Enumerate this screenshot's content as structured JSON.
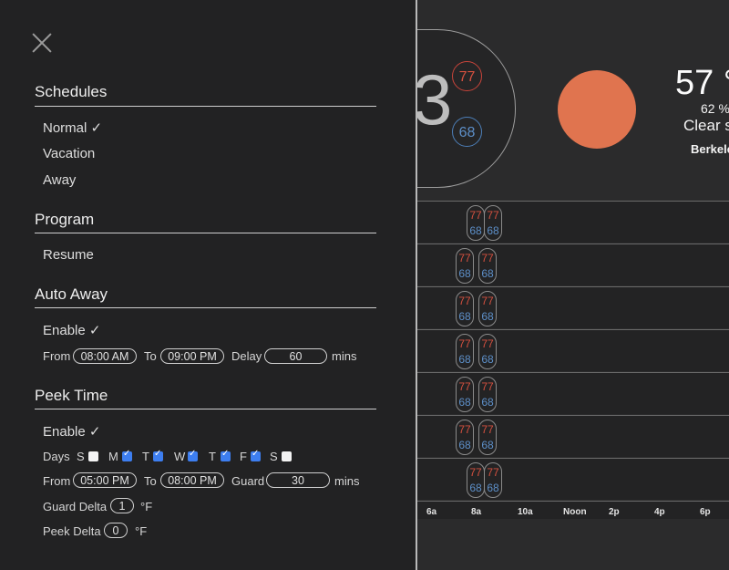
{
  "sidebar": {
    "close_icon": "close-icon",
    "schedules": {
      "title": "Schedules",
      "items": [
        "Normal ✓",
        "Vacation",
        "Away"
      ]
    },
    "program": {
      "title": "Program",
      "items": [
        "Resume"
      ]
    },
    "auto_away": {
      "title": "Auto Away",
      "enable": "Enable ✓",
      "from_label": "From",
      "from_value": "08:00 AM",
      "to_label": "To",
      "to_value": "09:00 PM",
      "delay_label": "Delay",
      "delay_value": "60",
      "delay_unit": "mins"
    },
    "peek_time": {
      "title": "Peek Time",
      "enable": "Enable ✓",
      "days_label": "Days",
      "days": [
        {
          "label": "S",
          "checked": false
        },
        {
          "label": "M",
          "checked": true
        },
        {
          "label": "T",
          "checked": true
        },
        {
          "label": "W",
          "checked": true
        },
        {
          "label": "T",
          "checked": true
        },
        {
          "label": "F",
          "checked": true
        },
        {
          "label": "S",
          "checked": false
        }
      ],
      "from_label": "From",
      "from_value": "05:00 PM",
      "to_label": "To",
      "to_value": "08:00 PM",
      "guard_label": "Guard",
      "guard_value": "30",
      "guard_unit": "mins",
      "guard_delta_label": "Guard Delta",
      "guard_delta_value": "1",
      "guard_delta_unit": "°F",
      "peek_delta_label": "Peek Delta",
      "peek_delta_value": "0",
      "peek_delta_unit": "°F"
    }
  },
  "thermostat": {
    "current_digit": "3",
    "heat_setpoint": "77",
    "cool_setpoint": "68"
  },
  "weather": {
    "icon": "sun-icon",
    "temperature": "57 °",
    "humidity": "62 %",
    "condition": "Clear s",
    "location": "Berkele"
  },
  "schedule_rows": [
    {
      "heat": "77",
      "cool": "68"
    },
    {
      "heat": "77",
      "cool": "68"
    },
    {
      "heat": "77",
      "cool": "68"
    },
    {
      "heat": "77",
      "cool": "68"
    },
    {
      "heat": "77",
      "cool": "68"
    },
    {
      "heat": "77",
      "cool": "68"
    },
    {
      "heat": "77",
      "cool": "68"
    }
  ],
  "axis_ticks": [
    "6a",
    "8a",
    "10a",
    "Noon",
    "2p",
    "4p",
    "6p"
  ],
  "colors": {
    "heat": "#d5503f",
    "cool": "#5d8fc8",
    "sun": "#e0744f",
    "checkbox": "#3d7ef0"
  }
}
